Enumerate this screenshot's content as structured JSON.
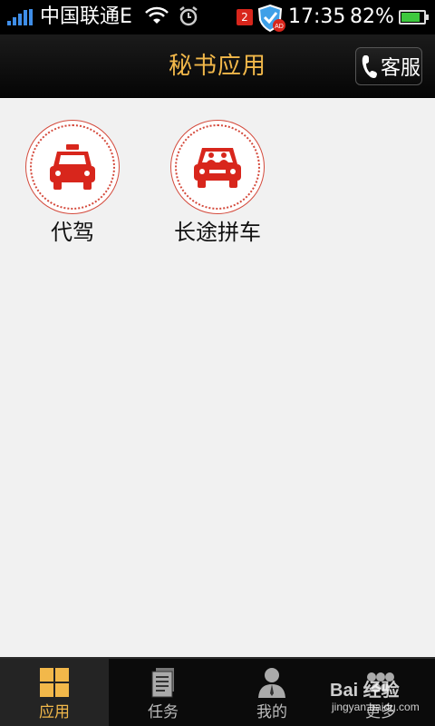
{
  "status_bar": {
    "carrier": "中国联通E",
    "notification_count": "2",
    "time": "17:35",
    "battery_percent": "82%",
    "battery_level": 0.82,
    "icons": [
      "signal-icon",
      "wifi-icon",
      "alarm-icon",
      "notification-icon",
      "shield-ad-icon",
      "battery-icon"
    ]
  },
  "header": {
    "title": "秘书应用",
    "service_button_label": "客服",
    "service_icon": "phone-icon"
  },
  "apps": [
    {
      "label": "代驾",
      "icon": "taxi-icon"
    },
    {
      "label": "长途拼车",
      "icon": "car-passengers-icon"
    }
  ],
  "tabs": [
    {
      "label": "应用",
      "icon": "grid-icon",
      "active": true
    },
    {
      "label": "任务",
      "icon": "document-icon",
      "active": false
    },
    {
      "label": "我的",
      "icon": "person-icon",
      "active": false
    },
    {
      "label": "更多",
      "icon": "more-icon",
      "active": false
    }
  ],
  "watermark": {
    "line1": "Bai 经验",
    "line2": "jingyan.baidu.com"
  },
  "colors": {
    "accent": "#f2b84a",
    "icon_red": "#d8261c",
    "background": "#f1f1f1",
    "bar": "#0b0b0b"
  }
}
